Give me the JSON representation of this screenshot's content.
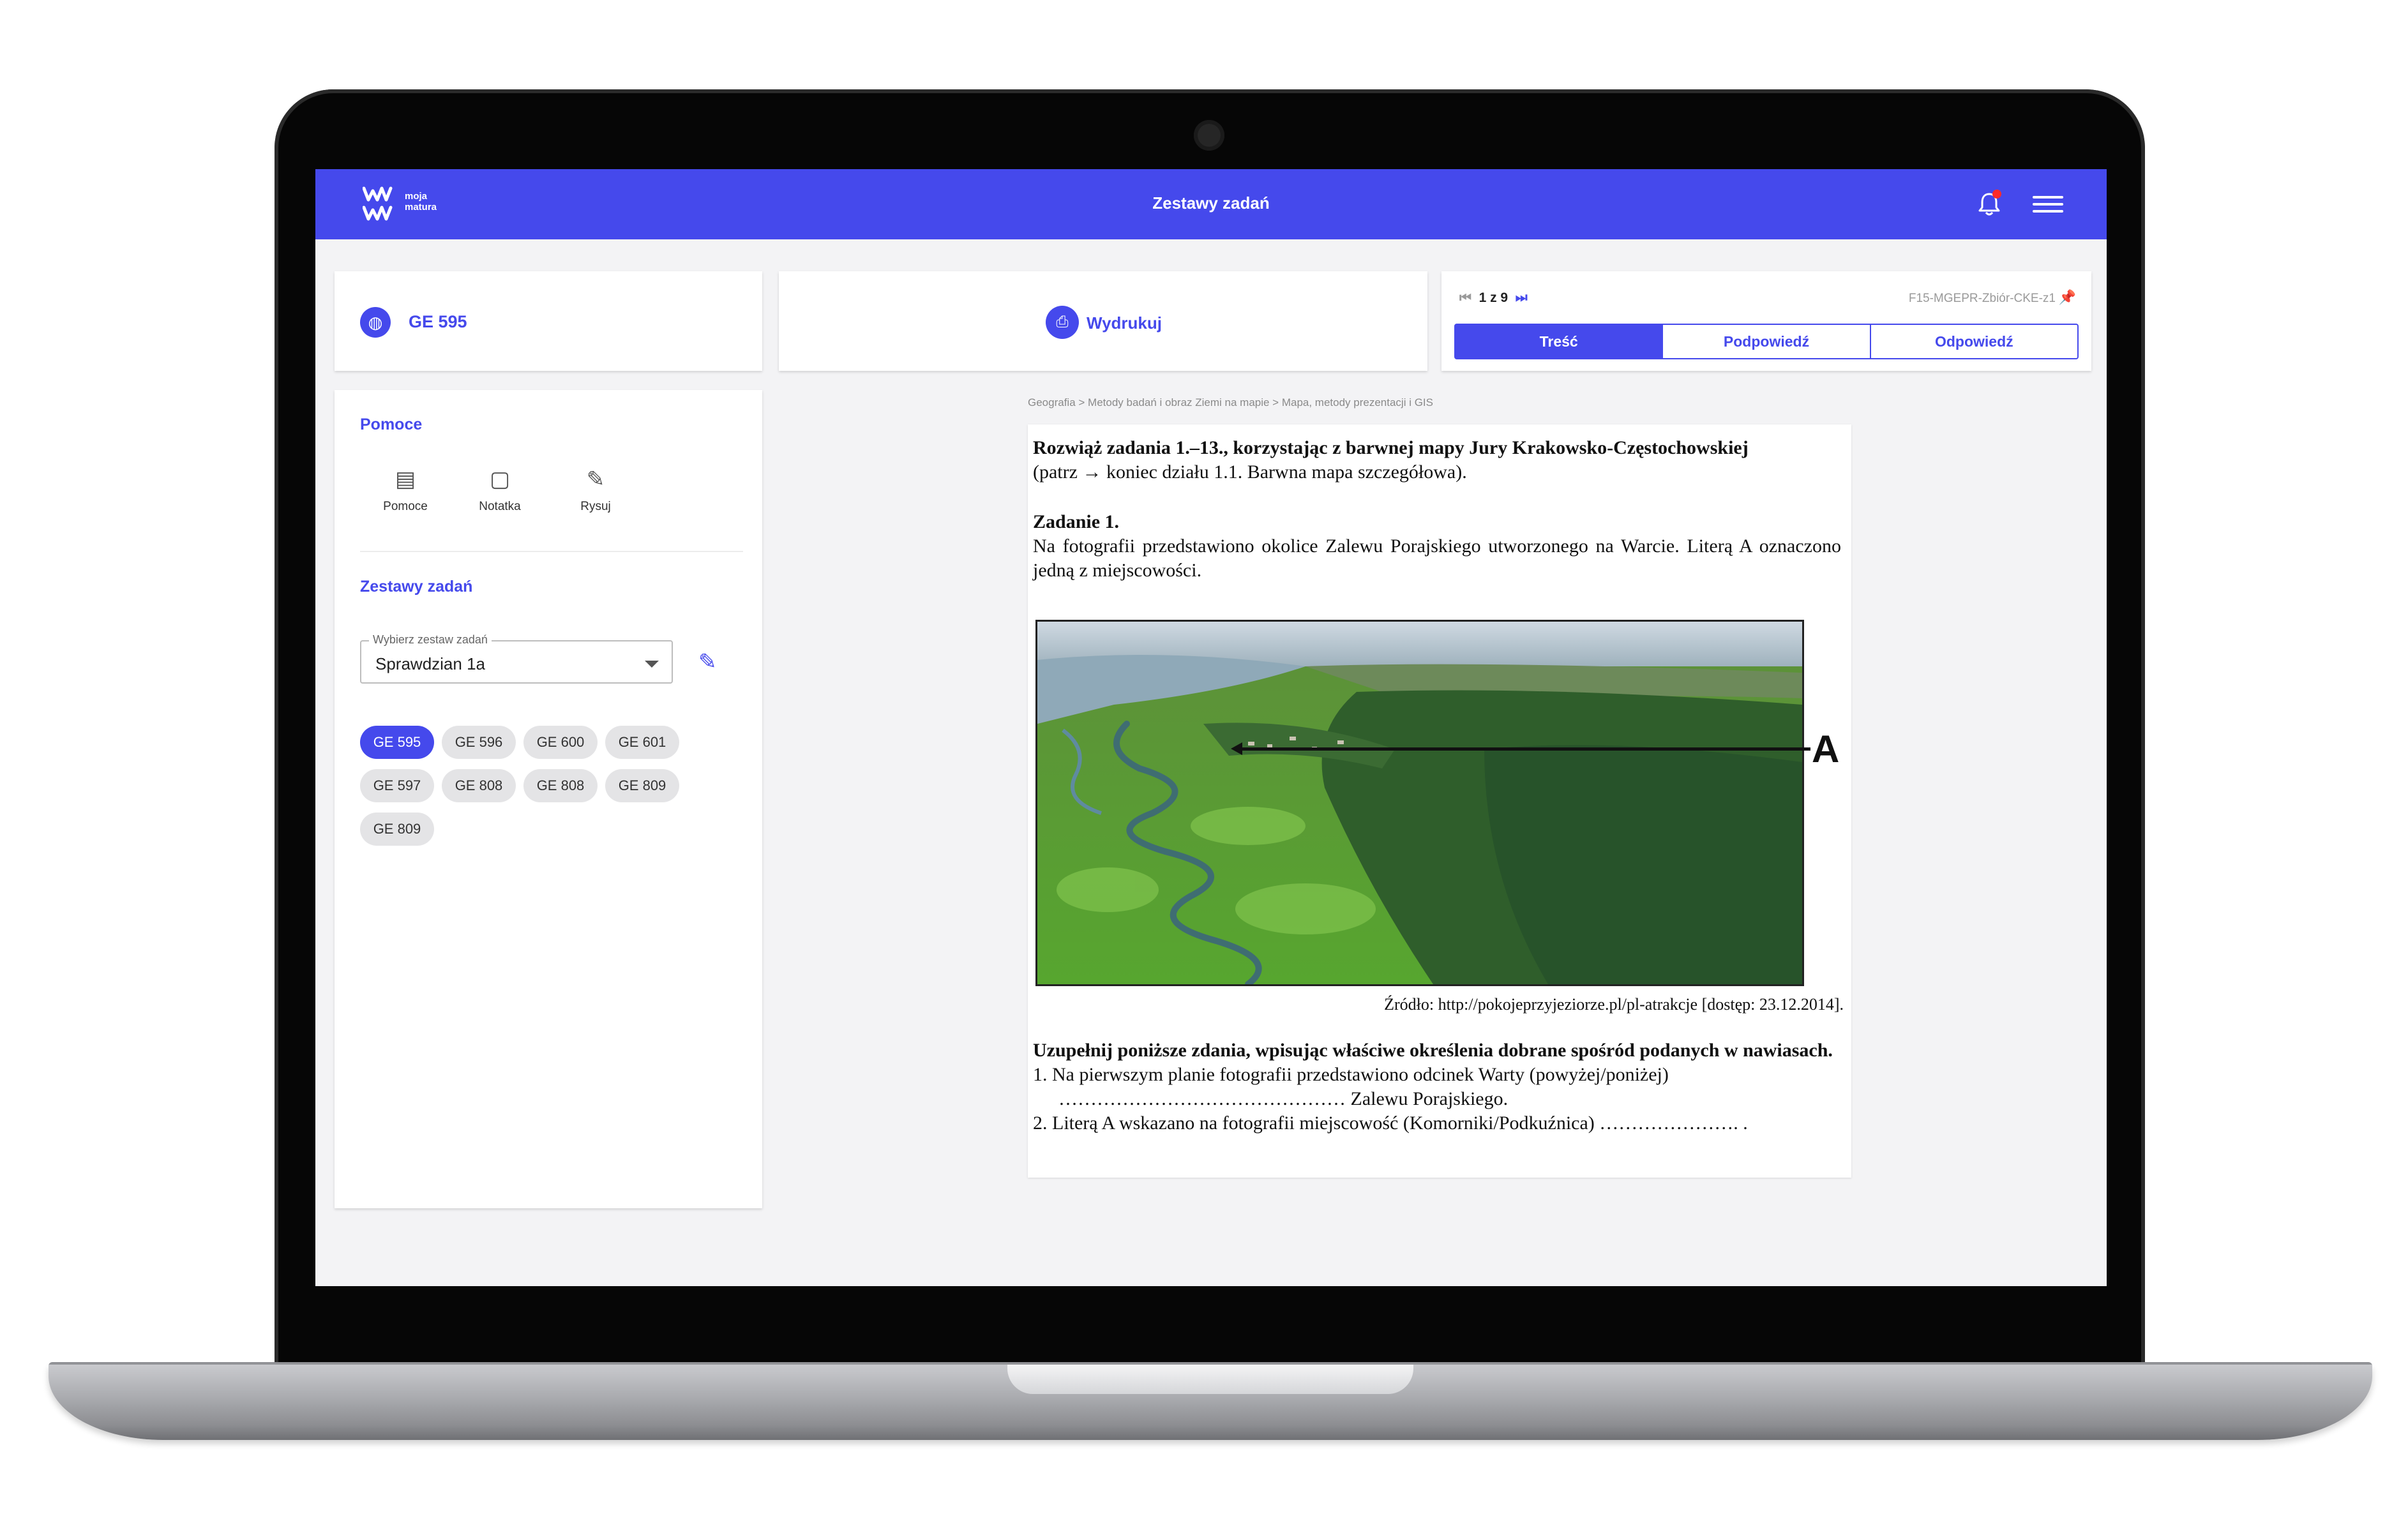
{
  "app": {
    "logo_line1": "moja",
    "logo_line2": "matura",
    "title": "Zestawy zadań"
  },
  "task_card": {
    "code": "GE 595"
  },
  "print_card": {
    "label": "Wydrukuj"
  },
  "pager": {
    "position": "1 z 9",
    "doc_id": "F15-MGEPR-Zbiór-CKE-z1",
    "tabs": [
      "Treść",
      "Podpowiedź",
      "Odpowiedź"
    ],
    "active_tab": "Treść"
  },
  "sidebar": {
    "tools_title": "Pomoce",
    "tools": [
      {
        "label": "Pomoce",
        "icon": "document-icon"
      },
      {
        "label": "Notatka",
        "icon": "note-icon"
      },
      {
        "label": "Rysuj",
        "icon": "pencil-icon"
      }
    ],
    "sets_title": "Zestawy zadań",
    "select_legend": "Wybierz zestaw zadań",
    "select_value": "Sprawdzian 1a",
    "chips": [
      "GE 595",
      "GE 596",
      "GE 600",
      "GE 601",
      "GE 597",
      "GE 808",
      "GE 808",
      "GE 809",
      "GE 809"
    ],
    "active_chip": "GE 595"
  },
  "breadcrumb": "Geografia > Metody badań i obraz Ziemi na mapie > Mapa, metody prezentacji i GIS",
  "document": {
    "intro_bold": "Rozwiąż zadania 1.–13., korzystając z barwnej mapy Jury Krakowsko-Częstochowskiej",
    "intro_rest": "(patrz → koniec działu 1.1. Barwna mapa szczegółowa).",
    "task_heading": "Zadanie 1.",
    "task_text": "Na fotografii przedstawiono okolice Zalewu Porajskiego utworzonego na Warcie. Literą A oznaczono jedną z miejscowości.",
    "photo_label": "A",
    "source": "Źródło: http://pokojeprzyjeziorze.pl/pl-atrakcje [dostęp: 23.12.2014].",
    "instruction": "Uzupełnij poniższe zdania, wpisując właściwe określenia dobrane spośród podanych w nawiasach.",
    "item1_a": "1. Na pierwszym planie fotografii przedstawiono odcinek Warty (powyżej/poniżej)",
    "item1_b": "……………………………………… Zalewu Porajskiego.",
    "item2": "2. Literą A wskazano na fotografii miejscowość (Komorniki/Podkuźnica) …………………. ."
  },
  "colors": {
    "accent": "#4549ec",
    "notification": "#ff2a2a"
  }
}
